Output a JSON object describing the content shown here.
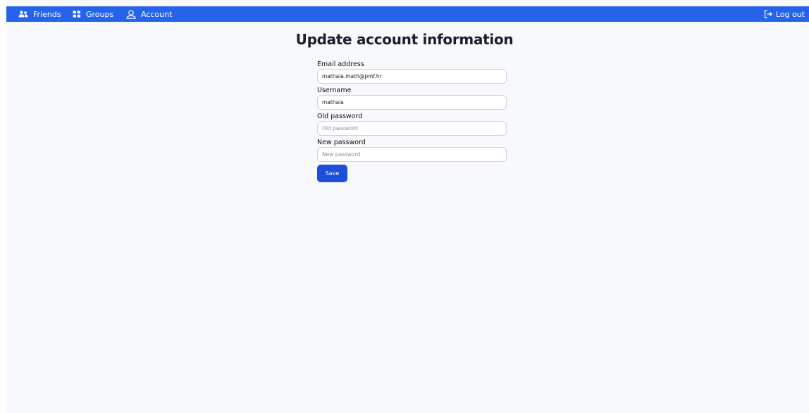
{
  "navbar": {
    "color": "#2563eb",
    "friends_label": "Friends",
    "groups_label": "Groups",
    "account_label": "Account",
    "logout_label": "Log out"
  },
  "page": {
    "title": "Update account information"
  },
  "form": {
    "email": {
      "label": "Email address",
      "value": "mathala.math@pmf.hr",
      "placeholder": ""
    },
    "username": {
      "label": "Username",
      "value": "mathala",
      "placeholder": ""
    },
    "old_password": {
      "label": "Old password",
      "value": "",
      "placeholder": "Old password"
    },
    "new_password": {
      "label": "New password",
      "value": "",
      "placeholder": "New password"
    },
    "save_label": "Save",
    "save_color": "#1d4fd8"
  }
}
